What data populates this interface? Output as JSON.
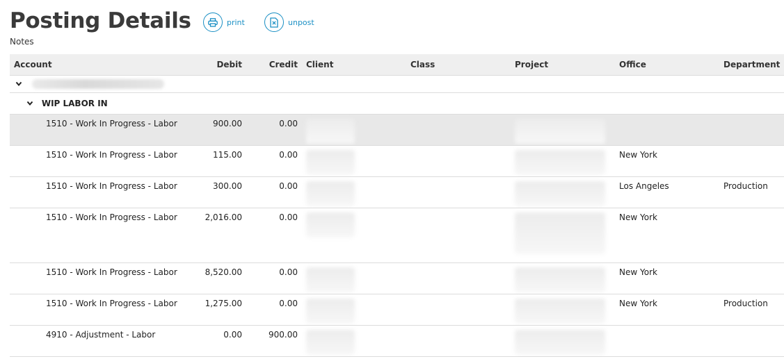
{
  "header": {
    "title": "Posting Details",
    "print_label": "print",
    "unpost_label": "unpost",
    "notes_label": "Notes"
  },
  "table": {
    "columns": {
      "account": "Account",
      "debit": "Debit",
      "credit": "Credit",
      "client": "Client",
      "class": "Class",
      "project": "Project",
      "office": "Office",
      "department": "Department"
    },
    "subgroup_label": "WIP LABOR IN",
    "rows": [
      {
        "account": "1510 - Work In Progress - Labor",
        "debit": "900.00",
        "credit": "0.00",
        "office": "",
        "department": ""
      },
      {
        "account": "1510 - Work In Progress - Labor",
        "debit": "115.00",
        "credit": "0.00",
        "office": "New York",
        "department": ""
      },
      {
        "account": "1510 - Work In Progress - Labor",
        "debit": "300.00",
        "credit": "0.00",
        "office": "Los Angeles",
        "department": "Production"
      },
      {
        "account": "1510 - Work In Progress - Labor",
        "debit": "2,016.00",
        "credit": "0.00",
        "office": "New York",
        "department": ""
      },
      {
        "account": "1510 - Work In Progress - Labor",
        "debit": "8,520.00",
        "credit": "0.00",
        "office": "New York",
        "department": ""
      },
      {
        "account": "1510 - Work In Progress - Labor",
        "debit": "1,275.00",
        "credit": "0.00",
        "office": "New York",
        "department": "Production"
      },
      {
        "account": "4910 - Adjustment - Labor",
        "debit": "0.00",
        "credit": "900.00",
        "office": "",
        "department": ""
      }
    ]
  },
  "colors": {
    "accent": "#1a8fc4",
    "header_bg": "#efefef",
    "highlight_row": "#e8e8e8"
  },
  "icons": {
    "print": "printer-icon",
    "unpost": "document-x-icon",
    "expand": "chevron-down-icon"
  }
}
